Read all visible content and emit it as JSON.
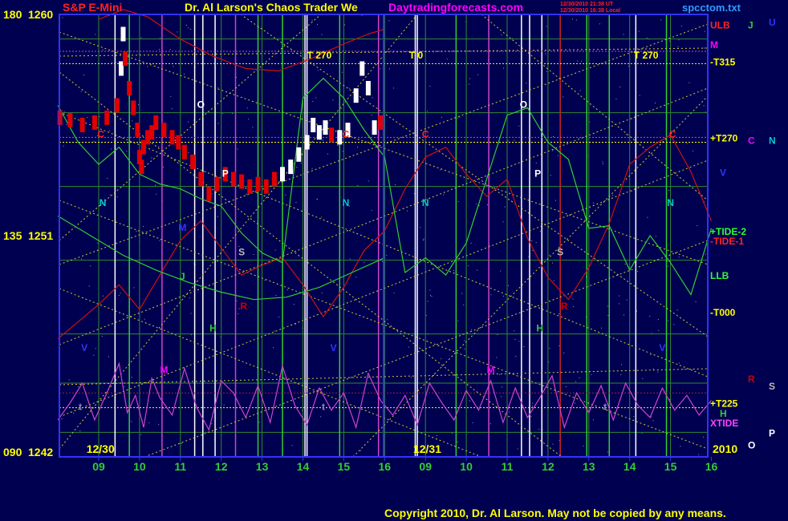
{
  "header": {
    "instrument": "S&P E-Mini",
    "title": "Dr. Al Larson's Chaos Trader We",
    "website": "Daytradingforecasts.com",
    "file": "spcctom.txt",
    "stamp_line1": "12/30/2010 21:38 UT",
    "stamp_line2": "12/30/2010 16:38 Local"
  },
  "footer": {
    "copyright": "Copyright 2010, Dr. Al Larson. May not be copied by any means."
  },
  "colors": {
    "background": "#000050",
    "frame": "#3232ff",
    "gold": "#ffff00",
    "price_up": "#ffffff",
    "price_down": "#e00000",
    "xtide": "#cc44cc",
    "green_line": "#33cc33",
    "red_line": "#cc1111",
    "cyan": "#00cccc"
  },
  "chart_data": {
    "type": "line",
    "xlabel": "",
    "ylabel": "",
    "y_axis": {
      "range": [
        1242,
        1260
      ],
      "ticks": [
        {
          "angle": "180",
          "price": "1260",
          "value": 1260
        },
        {
          "angle": "135",
          "price": "1251",
          "value": 1251
        },
        {
          "angle": "090",
          "price": "1242",
          "value": 1242
        }
      ]
    },
    "x_axis": {
      "range": [
        8,
        23
      ],
      "ticks": [
        {
          "label": "09",
          "x": 9
        },
        {
          "label": "10",
          "x": 10
        },
        {
          "label": "11",
          "x": 11
        },
        {
          "label": "12",
          "x": 12
        },
        {
          "label": "13",
          "x": 13
        },
        {
          "label": "14",
          "x": 14
        },
        {
          "label": "15",
          "x": 15
        },
        {
          "label": "16",
          "x": 16
        },
        {
          "label": "09",
          "x": 17
        },
        {
          "label": "10",
          "x": 18
        },
        {
          "label": "11",
          "x": 19
        },
        {
          "label": "12",
          "x": 20
        },
        {
          "label": "13",
          "x": 21
        },
        {
          "label": "14",
          "x": 22
        },
        {
          "label": "15",
          "x": 23
        },
        {
          "label": "16",
          "x": 24
        }
      ],
      "dates": [
        {
          "label": "12/30",
          "x": 8.7
        },
        {
          "label": "12/31",
          "x": 16.7
        }
      ],
      "year": "2010"
    },
    "price_bars": {
      "name": "S&P E-Mini",
      "x": [
        8.05,
        8.3,
        8.6,
        8.9,
        9.2,
        9.45,
        9.55,
        9.6,
        9.65,
        9.75,
        9.85,
        9.95,
        10.0,
        10.05,
        10.1,
        10.2,
        10.3,
        10.4,
        10.6,
        10.8,
        10.95,
        11.1,
        11.3,
        11.5,
        11.7,
        11.9,
        12.1,
        12.3,
        12.5,
        12.7,
        12.9,
        13.1,
        13.3,
        13.5,
        13.7,
        13.9,
        14.1,
        14.25,
        14.4,
        14.55,
        14.7,
        14.9,
        15.1,
        15.3,
        15.45,
        15.6,
        15.75,
        15.9
      ],
      "y": [
        1255.8,
        1255.7,
        1255.5,
        1255.6,
        1255.8,
        1256.3,
        1257.8,
        1259.2,
        1258.2,
        1257.0,
        1256.2,
        1255.3,
        1254.2,
        1253.8,
        1254.6,
        1255.0,
        1255.2,
        1255.6,
        1255.3,
        1255.0,
        1254.8,
        1254.4,
        1254.0,
        1253.3,
        1252.7,
        1253.1,
        1253.5,
        1253.3,
        1253.2,
        1253.0,
        1253.1,
        1253.0,
        1253.3,
        1253.5,
        1253.8,
        1254.3,
        1254.8,
        1255.5,
        1255.2,
        1255.4,
        1255.1,
        1255.0,
        1255.3,
        1256.7,
        1257.8,
        1257.0,
        1255.4,
        1255.6
      ],
      "up": [
        false,
        false,
        false,
        false,
        false,
        false,
        true,
        true,
        false,
        false,
        false,
        false,
        false,
        false,
        false,
        false,
        false,
        false,
        false,
        false,
        false,
        false,
        false,
        false,
        false,
        false,
        false,
        false,
        false,
        false,
        false,
        false,
        false,
        true,
        true,
        true,
        true,
        true,
        true,
        true,
        false,
        true,
        true,
        true,
        true,
        true,
        true,
        false
      ]
    },
    "series": [
      {
        "name": "XTIDE",
        "x": [
          8.0,
          8.3,
          8.6,
          8.9,
          9.2,
          9.5,
          9.7,
          9.9,
          10.1,
          10.3,
          10.5,
          10.8,
          11.1,
          11.4,
          11.7,
          12.0,
          12.3,
          12.6,
          12.9,
          13.2,
          13.5,
          13.8,
          14.1,
          14.4,
          14.7,
          15.0,
          15.3,
          15.6,
          15.9,
          16.2,
          16.5,
          16.8,
          17.1,
          17.4,
          17.7,
          18.0,
          18.3,
          18.6,
          18.9,
          19.2,
          19.5,
          19.8,
          20.1,
          20.4,
          20.7,
          21.0,
          21.3,
          21.6,
          21.9,
          22.2,
          22.5,
          22.8,
          23.1,
          23.4,
          23.7,
          24.0
        ],
        "y": [
          1243.5,
          1244.2,
          1245.0,
          1243.5,
          1244.6,
          1245.8,
          1243.8,
          1244.5,
          1243.2,
          1245.2,
          1244.4,
          1243.7,
          1245.6,
          1244.0,
          1243.1,
          1245.1,
          1244.6,
          1243.6,
          1244.9,
          1243.4,
          1245.7,
          1244.1,
          1243.3,
          1244.8,
          1243.9,
          1244.6,
          1243.2,
          1245.4,
          1244.3,
          1243.7,
          1244.5,
          1243.3,
          1245.0,
          1244.2,
          1243.5,
          1244.7,
          1243.9,
          1245.1,
          1243.4,
          1244.8,
          1243.6,
          1244.4,
          1245.3,
          1243.2,
          1244.6,
          1243.8,
          1244.9,
          1243.5,
          1245.0,
          1244.1,
          1243.6,
          1244.8,
          1243.9,
          1244.5,
          1243.7,
          1244.3
        ]
      },
      {
        "name": "TIDE-1",
        "x": [
          8.0,
          8.5,
          9.0,
          9.5,
          10.0,
          10.5,
          11.0,
          11.5,
          12.0,
          12.5,
          13.0,
          13.5,
          14.0,
          14.5,
          15.0,
          15.5,
          16.0,
          16.5,
          17.0,
          17.5,
          18.0,
          18.5,
          19.0,
          19.5,
          20.0,
          20.5,
          21.0,
          21.5,
          22.0,
          22.5,
          23.0,
          23.5,
          24.0
        ],
        "y": [
          1246.8,
          1247.5,
          1248.2,
          1249.0,
          1248.0,
          1249.4,
          1250.8,
          1251.6,
          1250.5,
          1249.4,
          1249.8,
          1250.1,
          1249.0,
          1247.7,
          1248.9,
          1250.4,
          1251.2,
          1252.9,
          1254.2,
          1254.6,
          1253.5,
          1252.6,
          1253.3,
          1250.9,
          1249.3,
          1248.4,
          1249.7,
          1251.5,
          1253.9,
          1254.6,
          1255.1,
          1253.6,
          1251.6
        ]
      },
      {
        "name": "TIDE-2",
        "x": [
          8.0,
          8.5,
          9.0,
          9.5,
          10.0,
          10.5,
          11.0,
          11.5,
          12.0,
          12.5,
          13.0,
          13.5,
          14.0,
          14.5,
          15.0,
          15.5,
          16.0,
          16.5,
          17.0,
          17.5,
          18.0,
          18.5,
          19.0,
          19.5,
          20.0,
          20.5,
          21.0,
          21.5,
          22.0,
          22.5,
          23.0,
          23.5,
          24.0
        ],
        "y": [
          1256.3,
          1254.8,
          1253.9,
          1254.6,
          1253.5,
          1253.1,
          1252.9,
          1252.5,
          1252.2,
          1251.1,
          1250.3,
          1249.9,
          1256.6,
          1257.4,
          1256.6,
          1255.3,
          1254.2,
          1249.5,
          1250.1,
          1249.4,
          1250.7,
          1253.3,
          1255.9,
          1256.2,
          1254.8,
          1254.1,
          1251.3,
          1251.4,
          1249.6,
          1251.0,
          1249.9,
          1248.6,
          1251.3
        ]
      },
      {
        "name": "ULB",
        "x": [
          9.0,
          9.6,
          10.2,
          11.0,
          11.8,
          12.6,
          13.4,
          14.2,
          15.0,
          15.6,
          16.0
        ],
        "y": [
          1259.8,
          1260.2,
          1259.9,
          1259.0,
          1258.3,
          1257.8,
          1257.7,
          1258.2,
          1258.8,
          1259.2,
          1259.4
        ]
      },
      {
        "name": "LLB",
        "x": [
          8.0,
          8.8,
          9.6,
          10.4,
          11.2,
          12.0,
          12.8,
          13.6,
          14.4,
          15.2,
          16.0
        ],
        "y": [
          1251.8,
          1251.0,
          1250.2,
          1249.6,
          1249.1,
          1248.7,
          1248.4,
          1248.5,
          1248.9,
          1249.5,
          1250.1
        ]
      }
    ],
    "level_labels": [
      {
        "text": "ULB",
        "y": 1259.6,
        "color": "#ff2222"
      },
      {
        "text": "M",
        "y": 1258.8,
        "color": "#ff00ff"
      },
      {
        "text": "-T315",
        "y": 1258.1,
        "color": "#ffff00"
      },
      {
        "text": "+T270",
        "y": 1255.0,
        "color": "#ffff00"
      },
      {
        "text": "+TIDE-2",
        "y": 1251.2,
        "color": "#33ff33"
      },
      {
        "text": "-TIDE-1",
        "y": 1250.8,
        "color": "#ff2222"
      },
      {
        "text": "LLB",
        "y": 1249.4,
        "color": "#33ff33"
      },
      {
        "text": "-T000",
        "y": 1247.9,
        "color": "#ffff00"
      },
      {
        "text": "+T225",
        "y": 1244.2,
        "color": "#ffff00"
      },
      {
        "text": "XTIDE",
        "y": 1243.4,
        "color": "#ff44ff"
      }
    ],
    "side_labels": [
      {
        "text": "J",
        "y": 1259.6,
        "color": "#33cc33",
        "col": 1
      },
      {
        "text": "U",
        "y": 1259.7,
        "color": "#3333ff",
        "col": 2
      },
      {
        "text": "C",
        "y": 1254.9,
        "color": "#ff00ff",
        "col": 1
      },
      {
        "text": "N",
        "y": 1254.9,
        "color": "#00cccc",
        "col": 2
      },
      {
        "text": "V",
        "y": 1253.6,
        "color": "#3333ff",
        "col": 0
      },
      {
        "text": "R",
        "y": 1245.2,
        "color": "#cc0000",
        "col": 1
      },
      {
        "text": "S",
        "y": 1244.9,
        "color": "#bbbbbb",
        "col": 2
      },
      {
        "text": "H",
        "y": 1243.8,
        "color": "#33cc33",
        "col": 0
      },
      {
        "text": "P",
        "y": 1243.0,
        "color": "#ffffff",
        "col": 2
      },
      {
        "text": "O",
        "y": 1242.5,
        "color": "#ffffff",
        "col": 1
      }
    ],
    "t_labels": [
      {
        "text": "T  270",
        "x": 14.1
      },
      {
        "text": "T  0",
        "x": 16.6
      },
      {
        "text": "T  270",
        "x": 22.1
      }
    ],
    "planet_markers": [
      {
        "text": "C",
        "x": 9.05,
        "y": 1255.0,
        "color": "#ff2222"
      },
      {
        "text": "C",
        "x": 15.05,
        "y": 1255.0,
        "color": "#ff2222"
      },
      {
        "text": "C",
        "x": 17.0,
        "y": 1255.0,
        "color": "#ff2222"
      },
      {
        "text": "C",
        "x": 23.05,
        "y": 1255.0,
        "color": "#ff2222"
      },
      {
        "text": "O",
        "x": 11.5,
        "y": 1256.2,
        "color": "#ffffff"
      },
      {
        "text": "O",
        "x": 19.4,
        "y": 1256.2,
        "color": "#ffffff"
      },
      {
        "text": "P",
        "x": 12.1,
        "y": 1253.4,
        "color": "#ffffff"
      },
      {
        "text": "P",
        "x": 19.75,
        "y": 1253.4,
        "color": "#ffffff"
      },
      {
        "text": "N",
        "x": 9.1,
        "y": 1252.2,
        "color": "#00cccc"
      },
      {
        "text": "N",
        "x": 15.05,
        "y": 1252.2,
        "color": "#00cccc"
      },
      {
        "text": "N",
        "x": 17.0,
        "y": 1252.2,
        "color": "#00cccc"
      },
      {
        "text": "N",
        "x": 23.0,
        "y": 1252.2,
        "color": "#00cccc"
      },
      {
        "text": "S",
        "x": 12.5,
        "y": 1250.2,
        "color": "#bbbbbb"
      },
      {
        "text": "S",
        "x": 20.3,
        "y": 1250.2,
        "color": "#bbbbbb"
      },
      {
        "text": "R",
        "x": 12.55,
        "y": 1248.0,
        "color": "#cc0000"
      },
      {
        "text": "R",
        "x": 20.4,
        "y": 1248.0,
        "color": "#cc0000"
      },
      {
        "text": "H",
        "x": 11.8,
        "y": 1247.1,
        "color": "#33cc33"
      },
      {
        "text": "H",
        "x": 19.8,
        "y": 1247.1,
        "color": "#33cc33"
      },
      {
        "text": "V",
        "x": 8.65,
        "y": 1246.3,
        "color": "#3333ff"
      },
      {
        "text": "V",
        "x": 14.75,
        "y": 1246.3,
        "color": "#3333ff"
      },
      {
        "text": "V",
        "x": 22.8,
        "y": 1246.3,
        "color": "#3333ff"
      },
      {
        "text": "M",
        "x": 10.6,
        "y": 1245.4,
        "color": "#ff00ff"
      },
      {
        "text": "M",
        "x": 18.6,
        "y": 1245.4,
        "color": "#ff00ff"
      },
      {
        "text": "t",
        "x": 8.55,
        "y": 1243.9,
        "color": "#8888cc"
      },
      {
        "text": "t",
        "x": 14.5,
        "y": 1243.9,
        "color": "#8888cc"
      },
      {
        "text": "t",
        "x": 21.4,
        "y": 1243.9,
        "color": "#8888cc"
      },
      {
        "text": "M",
        "x": 11.05,
        "y": 1251.2,
        "color": "#3333ff"
      },
      {
        "text": "J",
        "x": 11.05,
        "y": 1249.2,
        "color": "#33cc33"
      }
    ],
    "vertical_lines": [
      {
        "x": 9.4,
        "color": "#ffffff"
      },
      {
        "x": 11.35,
        "color": "#ffffff"
      },
      {
        "x": 11.55,
        "color": "#ffffff"
      },
      {
        "x": 11.85,
        "color": "#ffffff"
      },
      {
        "x": 14.05,
        "color": "#ffffff"
      },
      {
        "x": 14.1,
        "color": "#ffffff"
      },
      {
        "x": 16.75,
        "color": "#ffffff"
      },
      {
        "x": 16.8,
        "color": "#ffffff"
      },
      {
        "x": 19.35,
        "color": "#ffffff"
      },
      {
        "x": 19.55,
        "color": "#ffffff"
      },
      {
        "x": 19.85,
        "color": "#ffffff"
      },
      {
        "x": 22.15,
        "color": "#ffffff"
      },
      {
        "x": 10.55,
        "color": "#cc44cc"
      },
      {
        "x": 18.55,
        "color": "#cc44cc"
      },
      {
        "x": 12.35,
        "color": "#cc44cc"
      },
      {
        "x": 20.3,
        "color": "#cc2222"
      },
      {
        "x": 15.85,
        "color": "#cc44cc"
      },
      {
        "x": 9.75,
        "color": "#33cc33"
      },
      {
        "x": 12.9,
        "color": "#33cc33"
      },
      {
        "x": 13.5,
        "color": "#33cc33"
      },
      {
        "x": 14.9,
        "color": "#33cc33"
      },
      {
        "x": 17.75,
        "color": "#33cc33"
      },
      {
        "x": 20.95,
        "color": "#33cc33"
      },
      {
        "x": 21.5,
        "color": "#33cc33"
      },
      {
        "x": 22.9,
        "color": "#33cc33"
      }
    ],
    "horizontal_lines": [
      {
        "y": 1258.5,
        "color": "#cc44cc"
      },
      {
        "y": 1258.0,
        "color": "#ffff00"
      },
      {
        "y": 1255.0,
        "color": "#cc44cc"
      },
      {
        "y": 1254.8,
        "color": "#ffff00"
      },
      {
        "y": 1244.6,
        "color": "#aa2222"
      },
      {
        "y": 1244.0,
        "color": "#ffff00"
      }
    ]
  }
}
